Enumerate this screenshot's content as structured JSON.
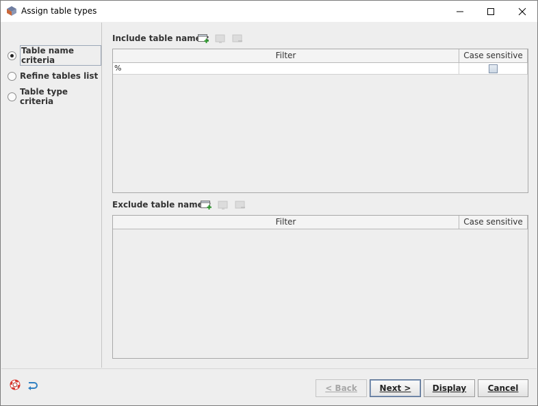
{
  "window": {
    "title": "Assign table types",
    "controls": {
      "minimize": "—",
      "maximize": "☐",
      "close": "✕"
    }
  },
  "left_nav": {
    "items": [
      {
        "label": "Table name criteria",
        "selected": true
      },
      {
        "label": "Refine tables list",
        "selected": false
      },
      {
        "label": "Table type criteria",
        "selected": false
      }
    ]
  },
  "include": {
    "label": "Include table names:",
    "columns": {
      "filter": "Filter",
      "case_sensitive": "Case sensitive"
    },
    "rows": [
      {
        "filter": "%",
        "case_sensitive": false
      }
    ],
    "tools": [
      "add-row-icon",
      "edit-row-icon",
      "remove-row-icon"
    ]
  },
  "exclude": {
    "label": "Exclude table names:",
    "columns": {
      "filter": "Filter",
      "case_sensitive": "Case sensitive"
    },
    "rows": [],
    "tools": [
      "add-row-icon",
      "edit-row-icon",
      "remove-row-icon"
    ]
  },
  "footer": {
    "icons": [
      "help-lifebuoy-icon",
      "reset-arrow-icon"
    ],
    "buttons": {
      "back": "< Back",
      "next": "Next >",
      "display": "Display",
      "cancel": "Cancel"
    }
  },
  "colors": {
    "add_accent": "#2e9a2e",
    "help_red": "#d9332b",
    "reset_blue": "#2f7fc1"
  }
}
